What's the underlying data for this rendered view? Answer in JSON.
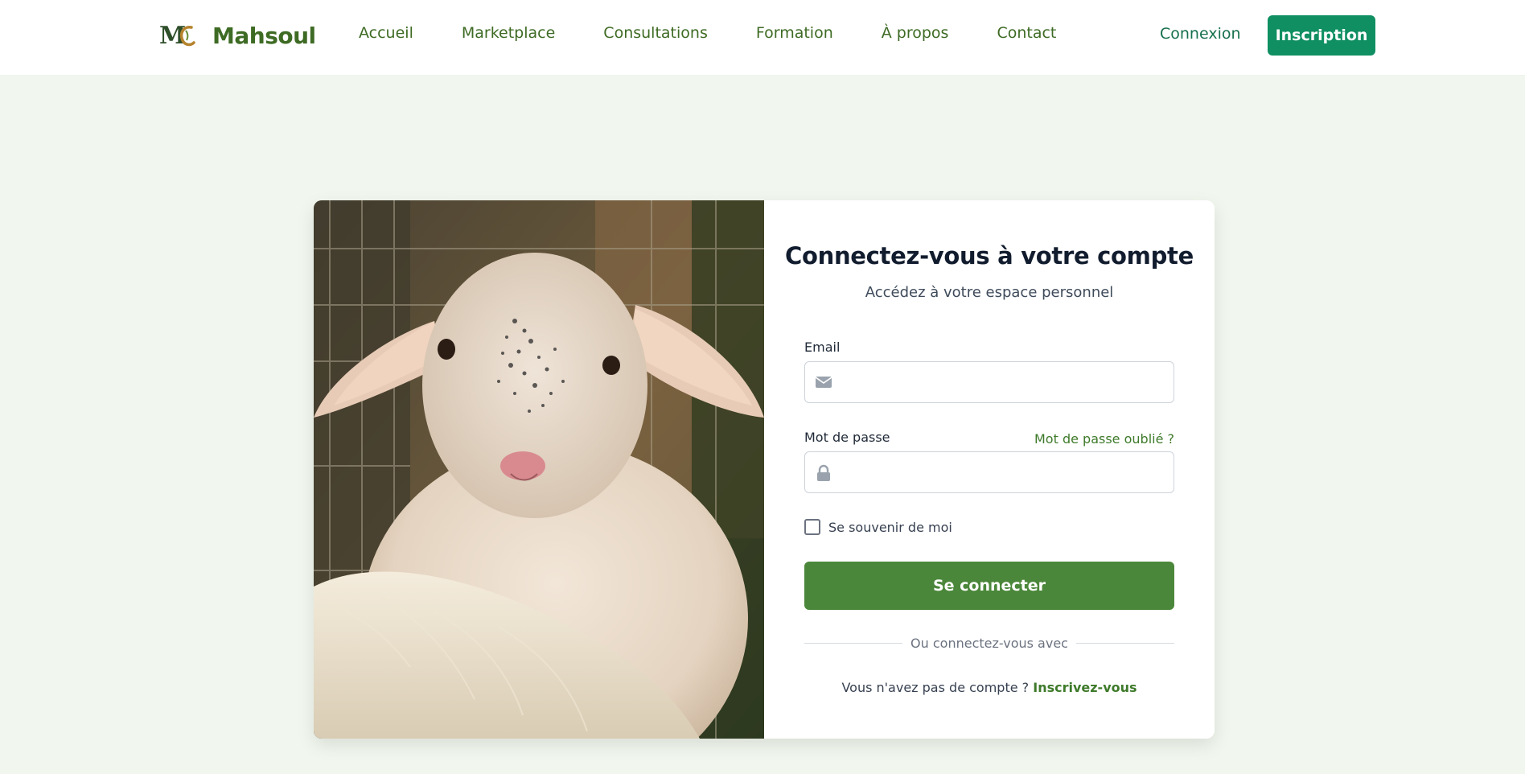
{
  "brand": {
    "name": "Mahsoul"
  },
  "nav": {
    "items": [
      {
        "label": "Accueil"
      },
      {
        "label": "Marketplace"
      },
      {
        "label": "Consultations"
      },
      {
        "label": "Formation"
      },
      {
        "label": "À propos"
      },
      {
        "label": "Contact"
      }
    ],
    "login_label": "Connexion",
    "signup_label": "Inscription"
  },
  "login": {
    "title": "Connectez-vous à votre compte",
    "subtitle": "Accédez à votre espace personnel",
    "email_label": "Email",
    "email_value": "",
    "password_label": "Mot de passe",
    "password_value": "",
    "forgot_label": "Mot de passe oublié ?",
    "remember_label": "Se souvenir de moi",
    "remember_checked": false,
    "submit_label": "Se connecter",
    "divider_text": "Ou connectez-vous avec",
    "no_account_text": "Vous n'avez pas de compte ?",
    "signup_link_label": "Inscrivez-vous"
  },
  "icons": {
    "email": "envelope-icon",
    "password": "lock-icon"
  },
  "colors": {
    "brand_green": "#3e6b24",
    "accent_teal": "#0f8f62",
    "button_green": "#4b873a",
    "page_bg": "#f1f7ee"
  }
}
